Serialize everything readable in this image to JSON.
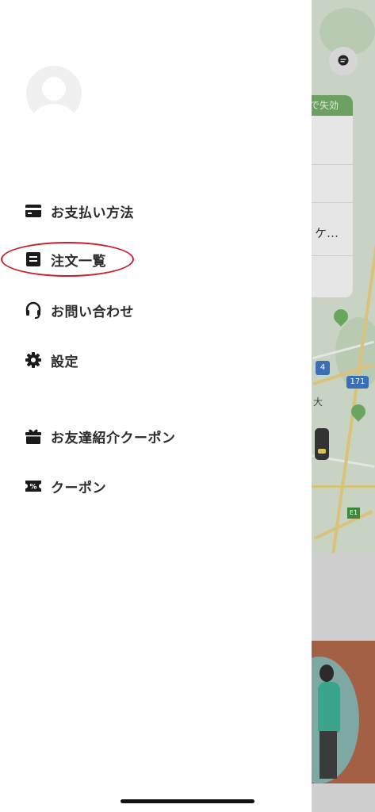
{
  "background": {
    "card_banner": "で失効",
    "card_text": "ケ…",
    "map_labels": {
      "route_4": "4",
      "route_171": "171",
      "route_e1": "E1",
      "place_char": "大"
    }
  },
  "menu": {
    "items": [
      {
        "label": "お支払い方法",
        "icon": "wallet-icon"
      },
      {
        "label": "注文一覧",
        "icon": "receipt-icon"
      },
      {
        "label": "お問い合わせ",
        "icon": "headset-icon"
      },
      {
        "label": "設定",
        "icon": "gear-icon"
      },
      {
        "label": "お友達紹介クーポン",
        "icon": "gift-icon"
      },
      {
        "label": "クーポン",
        "icon": "coupon-icon"
      }
    ]
  },
  "colors": {
    "highlight": "#c8202e",
    "text": "#2b2b2b",
    "map_green": "#6c9f62"
  }
}
